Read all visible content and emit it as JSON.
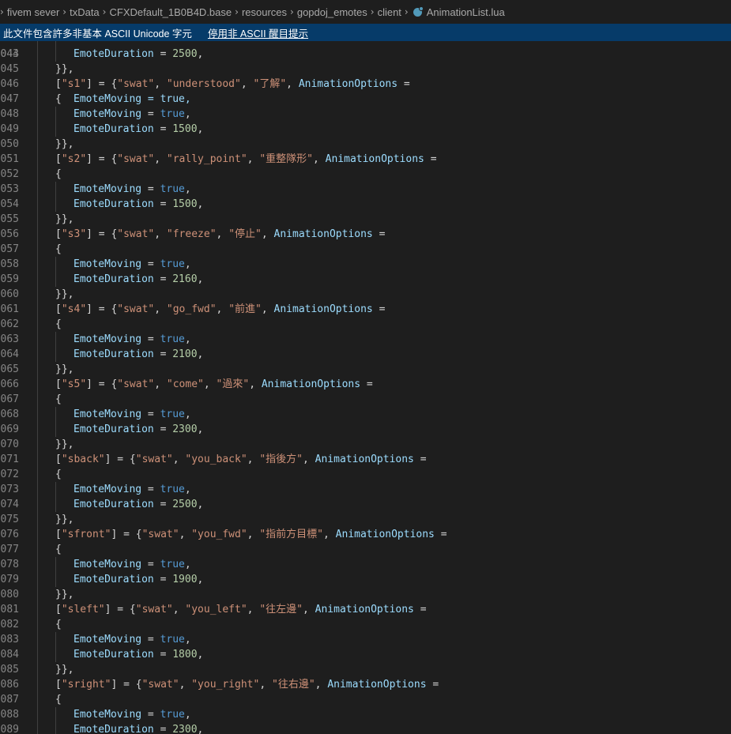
{
  "breadcrumb": {
    "items": [
      "fivem sever",
      "txData",
      "CFXDefault_1B0B4D.base",
      "resources",
      "gopdoj_emotes",
      "client"
    ],
    "file": "AnimationList.lua",
    "file_icon": "lua-file-icon"
  },
  "banner": {
    "message": "此文件包含許多非基本 ASCII Unicode 字元",
    "action": "停用非 ASCII 醒目提示"
  },
  "editor": {
    "first_line_partial": "EmoteMoving = true,",
    "lines": [
      {
        "n": "044",
        "t": "prop",
        "name": "EmoteDuration",
        "val": "2500"
      },
      {
        "n": "045",
        "t": "close"
      },
      {
        "n": "046",
        "t": "head",
        "key": "s1",
        "a": "swat",
        "b": "understood",
        "c": "了解"
      },
      {
        "n": "047",
        "t": "open"
      },
      {
        "n": "048",
        "t": "bool",
        "name": "EmoteMoving",
        "val": "true"
      },
      {
        "n": "049",
        "t": "prop",
        "name": "EmoteDuration",
        "val": "1500"
      },
      {
        "n": "050",
        "t": "close"
      },
      {
        "n": "051",
        "t": "head",
        "key": "s2",
        "a": "swat",
        "b": "rally_point",
        "c": "重整隊形"
      },
      {
        "n": "052",
        "t": "open"
      },
      {
        "n": "053",
        "t": "bool",
        "name": "EmoteMoving",
        "val": "true"
      },
      {
        "n": "054",
        "t": "prop",
        "name": "EmoteDuration",
        "val": "1500"
      },
      {
        "n": "055",
        "t": "close"
      },
      {
        "n": "056",
        "t": "head",
        "key": "s3",
        "a": "swat",
        "b": "freeze",
        "c": "停止"
      },
      {
        "n": "057",
        "t": "open"
      },
      {
        "n": "058",
        "t": "bool",
        "name": "EmoteMoving",
        "val": "true"
      },
      {
        "n": "059",
        "t": "prop",
        "name": "EmoteDuration",
        "val": "2160"
      },
      {
        "n": "060",
        "t": "close"
      },
      {
        "n": "061",
        "t": "head",
        "key": "s4",
        "a": "swat",
        "b": "go_fwd",
        "c": "前進"
      },
      {
        "n": "062",
        "t": "open"
      },
      {
        "n": "063",
        "t": "bool",
        "name": "EmoteMoving",
        "val": "true"
      },
      {
        "n": "064",
        "t": "prop",
        "name": "EmoteDuration",
        "val": "2100"
      },
      {
        "n": "065",
        "t": "close"
      },
      {
        "n": "066",
        "t": "head",
        "key": "s5",
        "a": "swat",
        "b": "come",
        "c": "過來"
      },
      {
        "n": "067",
        "t": "open"
      },
      {
        "n": "068",
        "t": "bool",
        "name": "EmoteMoving",
        "val": "true"
      },
      {
        "n": "069",
        "t": "prop",
        "name": "EmoteDuration",
        "val": "2300"
      },
      {
        "n": "070",
        "t": "close"
      },
      {
        "n": "071",
        "t": "head",
        "key": "sback",
        "a": "swat",
        "b": "you_back",
        "c": "指後方"
      },
      {
        "n": "072",
        "t": "open"
      },
      {
        "n": "073",
        "t": "bool",
        "name": "EmoteMoving",
        "val": "true"
      },
      {
        "n": "074",
        "t": "prop",
        "name": "EmoteDuration",
        "val": "2500"
      },
      {
        "n": "075",
        "t": "close"
      },
      {
        "n": "076",
        "t": "head",
        "key": "sfront",
        "a": "swat",
        "b": "you_fwd",
        "c": "指前方目標"
      },
      {
        "n": "077",
        "t": "open"
      },
      {
        "n": "078",
        "t": "bool",
        "name": "EmoteMoving",
        "val": "true"
      },
      {
        "n": "079",
        "t": "prop",
        "name": "EmoteDuration",
        "val": "1900"
      },
      {
        "n": "080",
        "t": "close"
      },
      {
        "n": "081",
        "t": "head",
        "key": "sleft",
        "a": "swat",
        "b": "you_left",
        "c": "往左邊"
      },
      {
        "n": "082",
        "t": "open"
      },
      {
        "n": "083",
        "t": "bool",
        "name": "EmoteMoving",
        "val": "true"
      },
      {
        "n": "084",
        "t": "prop",
        "name": "EmoteDuration",
        "val": "1800"
      },
      {
        "n": "085",
        "t": "close"
      },
      {
        "n": "086",
        "t": "head",
        "key": "sright",
        "a": "swat",
        "b": "you_right",
        "c": "往右邊"
      },
      {
        "n": "087",
        "t": "open"
      },
      {
        "n": "088",
        "t": "bool",
        "name": "EmoteMoving",
        "val": "true"
      },
      {
        "n": "089",
        "t": "prop",
        "name": "EmoteDuration",
        "val": "2300"
      }
    ]
  }
}
